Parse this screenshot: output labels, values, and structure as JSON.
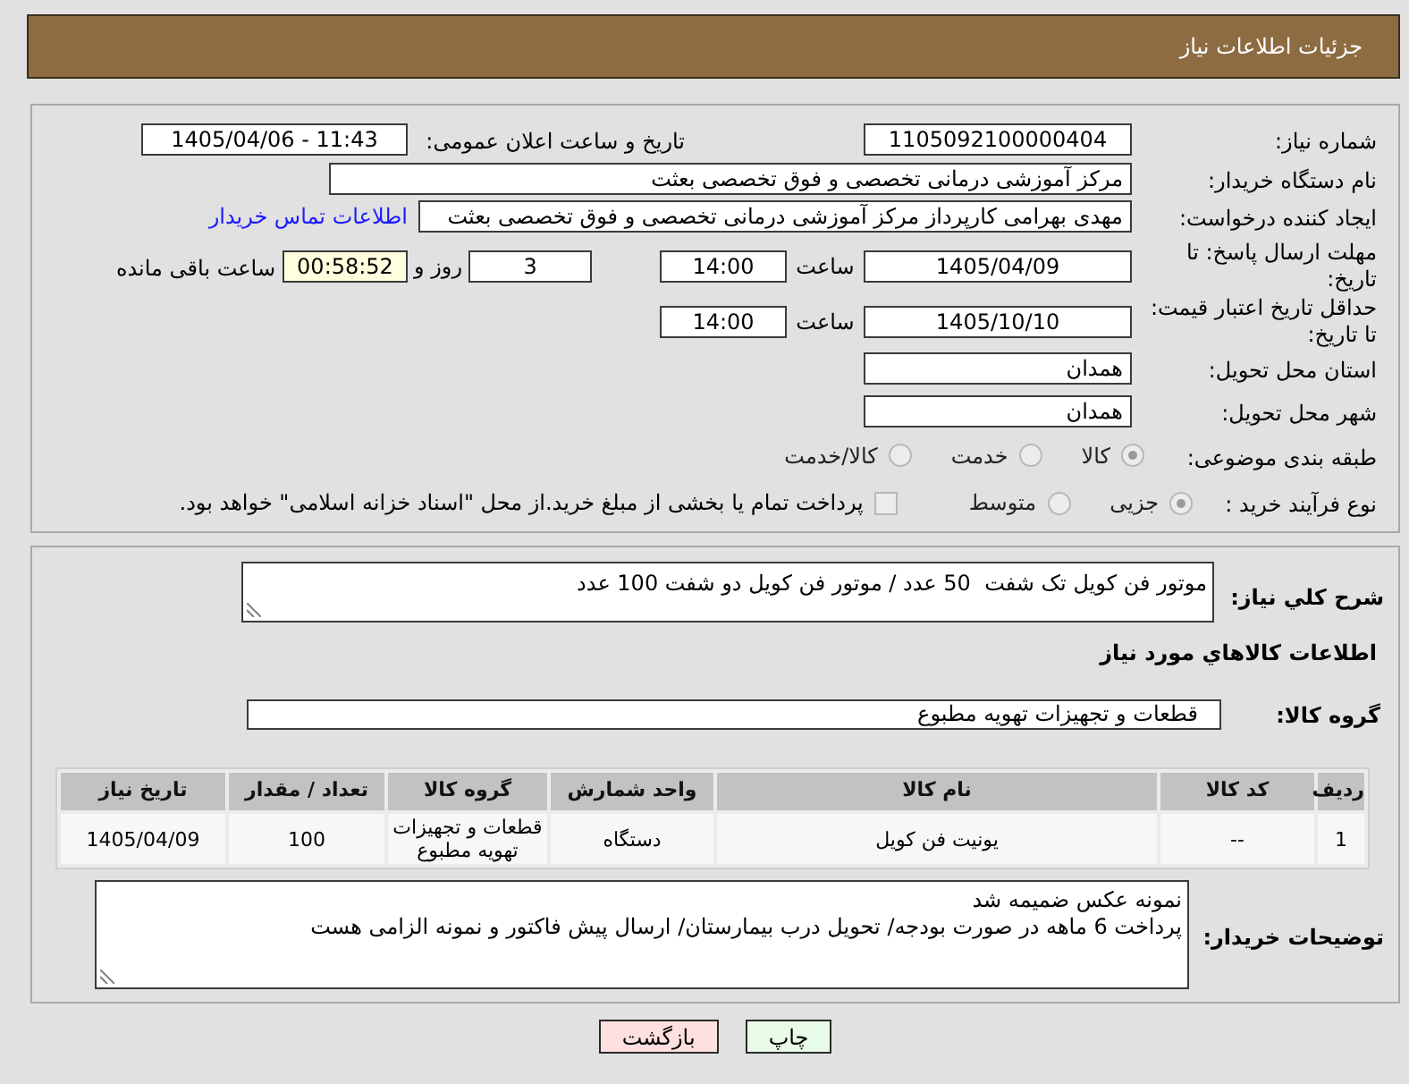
{
  "header": {
    "title": "جزئیات اطلاعات نیاز"
  },
  "details": {
    "need_number": {
      "label": "شماره نیاز:",
      "value": "1105092100000404"
    },
    "announce_datetime": {
      "label": "تاریخ و ساعت اعلان عمومی:",
      "value": "1405/04/06 - 11:43"
    },
    "buyer_org": {
      "label": "نام دستگاه خریدار:",
      "value": "مرکز آموزشی درمانی تخصصی و فوق تخصصی بعثت"
    },
    "requester": {
      "label": "ایجاد کننده درخواست:",
      "value": "مهدی بهرامی کارپرداز مرکز آموزشی درمانی تخصصی و فوق تخصصی بعثت",
      "link": "اطلاعات تماس خریدار"
    },
    "response_deadline": {
      "label": "مهلت ارسال پاسخ: تا تاریخ:",
      "date": "1405/04/09",
      "time_label": "ساعت",
      "time": "14:00",
      "days": "3",
      "days_label": "روز و",
      "remaining": "00:58:52",
      "remaining_label": "ساعت باقی مانده"
    },
    "price_validity": {
      "label": "حداقل تاریخ اعتبار قیمت: تا تاریخ:",
      "date": "1405/10/10",
      "time_label": "ساعت",
      "time": "14:00"
    },
    "province": {
      "label": "استان محل تحویل:",
      "value": "همدان"
    },
    "city": {
      "label": "شهر محل تحویل:",
      "value": "همدان"
    },
    "category": {
      "label": "طبقه بندی موضوعی:",
      "options": [
        {
          "label": "کالا",
          "selected": true,
          "disabled": true
        },
        {
          "label": "خدمت",
          "selected": false,
          "disabled": true
        },
        {
          "label": "کالا/خدمت",
          "selected": false,
          "disabled": true
        }
      ]
    },
    "purchase_type": {
      "label": "نوع فرآیند خرید :",
      "options": [
        {
          "label": "جزیی",
          "selected": true,
          "disabled": true
        },
        {
          "label": "متوسط",
          "selected": false,
          "disabled": true
        }
      ],
      "treasury": {
        "label": "پرداخت تمام یا بخشی از مبلغ خرید.از محل \"اسناد خزانه اسلامی\" خواهد بود.",
        "checked": false,
        "disabled": true
      }
    }
  },
  "description": {
    "label": "شرح کلي نیاز:",
    "value": "موتور فن کویل تک شفت  50 عدد / موتور فن کویل دو شفت 100 عدد"
  },
  "goods": {
    "title": "اطلاعات کالاهاي مورد نیاز",
    "group": {
      "label": "گروه کالا:",
      "value": "قطعات و تجهیزات تهویه مطبوع"
    },
    "table": {
      "columns": [
        "ردیف",
        "کد کالا",
        "نام کالا",
        "واحد شمارش",
        "گروه کالا",
        "تعداد / مقدار",
        "تاریخ نیاز"
      ],
      "rows": [
        [
          "1",
          "--",
          "یونیت فن کویل",
          "دستگاه",
          "قطعات و تجهیزات تهویه مطبوع",
          "100",
          "1405/04/09"
        ]
      ]
    }
  },
  "buyer_notes": {
    "label": "توضیحات خریدار:",
    "value": "نمونه عکس ضمیمه شد\nپرداخت 6 ماهه در صورت بودجه/ تحویل درب بیمارستان/ ارسال پیش فاکتور و نمونه الزامی هست"
  },
  "buttons": [
    {
      "label": "چاپ",
      "kind": "print"
    },
    {
      "label": "بازگشت",
      "kind": "back"
    }
  ]
}
